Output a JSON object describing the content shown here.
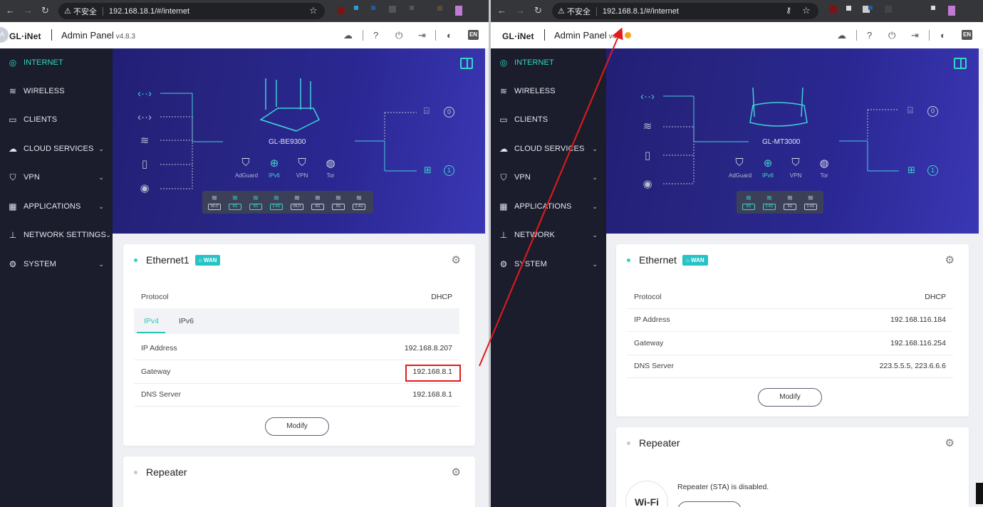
{
  "left": {
    "url": "192.168.18.1/#/internet",
    "insecure": "不安全",
    "brand": "GL·iNet",
    "avatar": "A",
    "title": "Admin Panel",
    "version": "v4.8.3",
    "lang": "EN",
    "device_name": "GL-BE9300",
    "services": [
      {
        "label": "AdGuard",
        "icon": "shield-icon"
      },
      {
        "label": "IPv6",
        "icon": "globe-icon"
      },
      {
        "label": "VPN",
        "icon": "vpn-icon"
      },
      {
        "label": "Tor",
        "icon": "tor-icon"
      }
    ],
    "right_counts": [
      "0",
      "1"
    ],
    "wifi_bands": [
      "MLO",
      "6G",
      "5G",
      "2.4G",
      "MLO",
      "6G",
      "5G",
      "2.4G"
    ],
    "card1": {
      "title": "Ethernet1",
      "badge": "WAN",
      "protocol_label": "Protocol",
      "protocol_value": "DHCP",
      "tab_ipv4": "IPv4",
      "tab_ipv6": "IPv6",
      "rows": [
        {
          "label": "IP Address",
          "value": "192.168.8.207"
        },
        {
          "label": "Gateway",
          "value": "192.168.8.1"
        },
        {
          "label": "DNS Server",
          "value": "192.168.8.1"
        }
      ],
      "modify": "Modify"
    },
    "card2": {
      "title": "Repeater"
    }
  },
  "right": {
    "url": "192.168.8.1/#/internet",
    "insecure": "不安全",
    "brand": "GL·iNet",
    "title": "Admin Panel",
    "version": "v4.7",
    "lang": "EN",
    "device_name": "GL-MT3000",
    "services": [
      {
        "label": "AdGuard",
        "icon": "shield-icon"
      },
      {
        "label": "IPv6",
        "icon": "globe-icon"
      },
      {
        "label": "VPN",
        "icon": "vpn-icon"
      },
      {
        "label": "Tor",
        "icon": "tor-icon"
      }
    ],
    "right_counts": [
      "0",
      "1"
    ],
    "wifi_bands": [
      "5G",
      "2.4G",
      "5G",
      "2.4G"
    ],
    "card1": {
      "title": "Ethernet",
      "badge": "WAN",
      "protocol_label": "Protocol",
      "protocol_value": "DHCP",
      "rows": [
        {
          "label": "IP Address",
          "value": "192.168.116.184"
        },
        {
          "label": "Gateway",
          "value": "192.168.116.254"
        },
        {
          "label": "DNS Server",
          "value": "223.5.5.5, 223.6.6.6"
        }
      ],
      "modify": "Modify"
    },
    "card2": {
      "title": "Repeater",
      "status": "Repeater (STA) is disabled.",
      "icon_text": "Wi-Fi"
    }
  },
  "sidebar_left": [
    "INTERNET",
    "WIRELESS",
    "CLIENTS",
    "CLOUD SERVICES",
    "VPN",
    "APPLICATIONS",
    "NETWORK SETTINGS",
    "SYSTEM"
  ],
  "sidebar_right": [
    "INTERNET",
    "WIRELESS",
    "CLIENTS",
    "CLOUD SERVICES",
    "VPN",
    "APPLICATIONS",
    "NETWORK",
    "SYSTEM"
  ],
  "colors": {
    "accent": "#33d6c0",
    "sidebar": "#1b1d2c",
    "highlight": "#e21b1b"
  }
}
